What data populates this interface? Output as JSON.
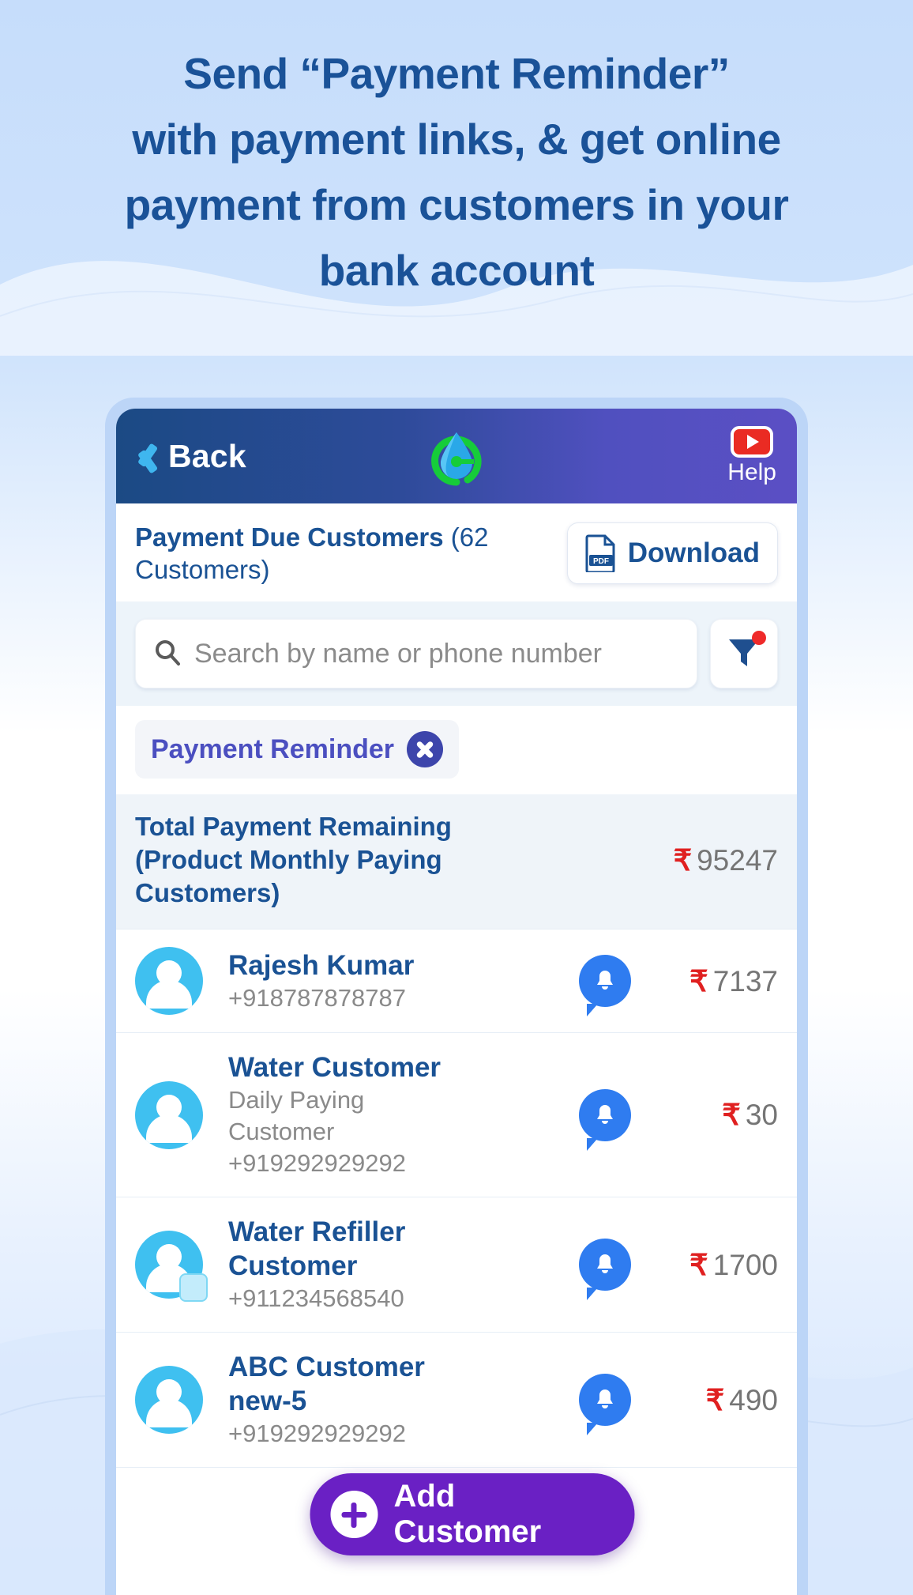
{
  "headline": {
    "lines": [
      "Send “Payment Reminder”",
      "with payment links, & get online",
      "payment from customers in your",
      "bank account"
    ],
    "color": "#1a5298"
  },
  "appbar": {
    "back_label": "Back",
    "back_icon": "chevron-left-icon",
    "logo_icon": "water-drop-logo-icon",
    "help_label": "Help",
    "help_icon": "youtube-play-icon",
    "gradient_from": "#1b4a84",
    "gradient_to": "#5b4fc4"
  },
  "screen": {
    "title_bold": "Payment Due Customers",
    "title_count": " (62 Customers)",
    "download": {
      "label": "Download",
      "icon": "pdf-file-icon"
    },
    "search": {
      "placeholder": "Search by name or phone number",
      "icon": "search-icon"
    },
    "filter": {
      "icon": "filter-funnel-icon",
      "badge": true
    },
    "chip": {
      "label": "Payment Reminder",
      "close_icon": "close-circle-icon"
    },
    "total": {
      "label": "Total Payment Remaining (Product Monthly Paying Customers)",
      "currency": "₹",
      "amount": "95247"
    },
    "currency": "₹",
    "customers": [
      {
        "name": "Rajesh Kumar",
        "sub": "",
        "phone": "+918787878787",
        "amount": "7137",
        "avatar": "person-avatar",
        "reminder_icon": "bell-notification-icon"
      },
      {
        "name": "Water Customer",
        "sub": "Daily Paying Customer",
        "phone": "+919292929292",
        "amount": "30",
        "avatar": "person-avatar",
        "reminder_icon": "bell-notification-icon"
      },
      {
        "name": "Water Refiller Customer",
        "sub": "",
        "phone": "+911234568540",
        "amount": "1700",
        "avatar": "person-avatar-refiller",
        "reminder_icon": "bell-notification-icon"
      },
      {
        "name": "ABC Customer new-5",
        "sub": "",
        "phone": "+919292929292",
        "amount": "490",
        "avatar": "person-avatar",
        "reminder_icon": "bell-notification-icon"
      }
    ],
    "fab": {
      "label": "Add Customer",
      "icon": "plus-circle-icon",
      "color": "#6a20c4"
    }
  }
}
